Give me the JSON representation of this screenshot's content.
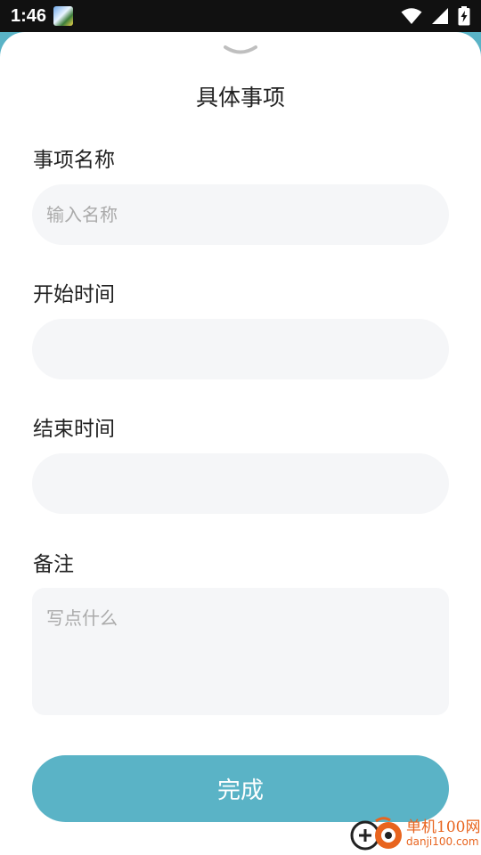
{
  "status_bar": {
    "time": "1:46",
    "icons": [
      "app-notification-icon",
      "wifi-icon",
      "cellular-signal-icon",
      "battery-charging-icon"
    ]
  },
  "sheet": {
    "title": "具体事项",
    "collapse_icon": "chevron-down-icon"
  },
  "form": {
    "name": {
      "label": "事项名称",
      "value": "",
      "placeholder": "输入名称"
    },
    "start_time": {
      "label": "开始时间",
      "value": "",
      "placeholder": ""
    },
    "end_time": {
      "label": "结束时间",
      "value": "",
      "placeholder": ""
    },
    "note": {
      "label": "备注",
      "value": "",
      "placeholder": "写点什么"
    }
  },
  "actions": {
    "done_label": "完成"
  },
  "watermark": {
    "name": "单机100网",
    "url": "danji100.com"
  },
  "colors": {
    "accent": "#5ab3c6",
    "input_background": "#f5f6f8",
    "status_bar": "#111111",
    "watermark": "#e8641e"
  }
}
